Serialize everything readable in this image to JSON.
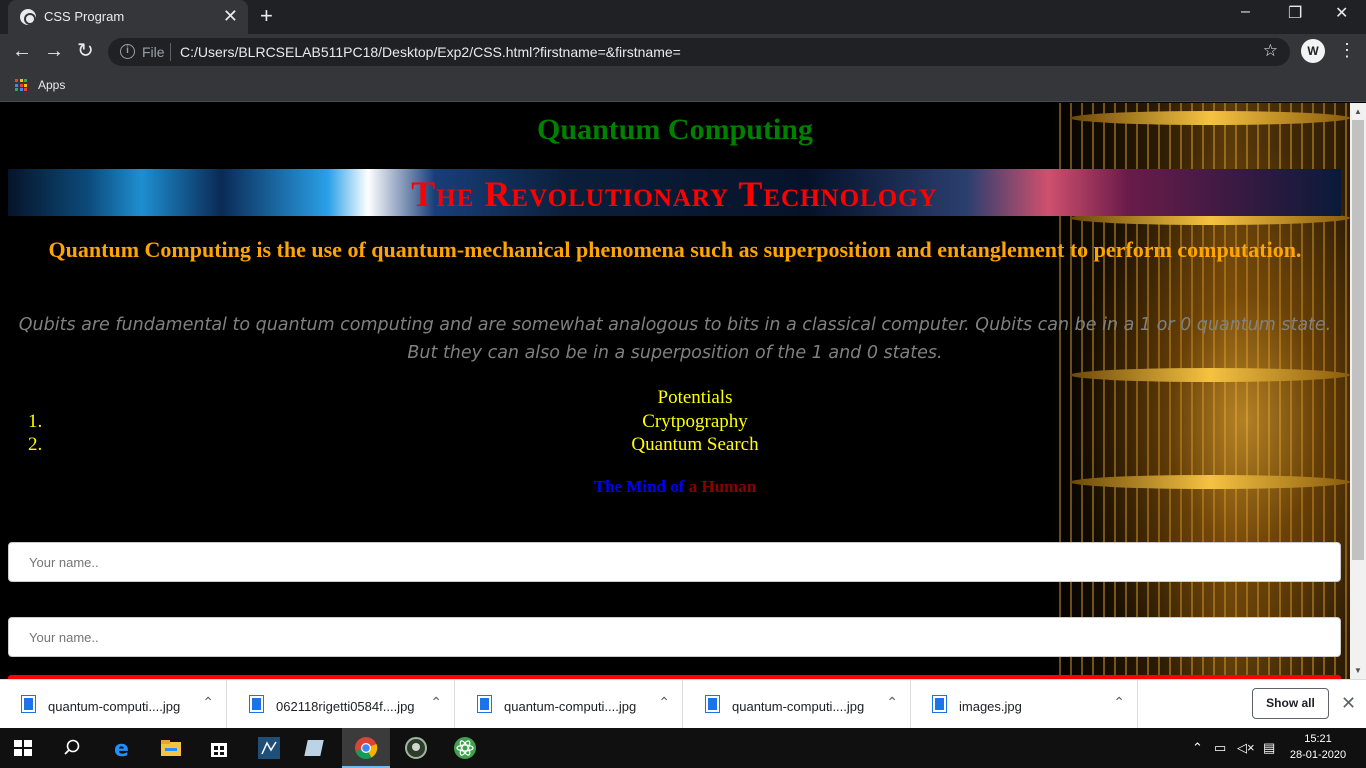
{
  "browser": {
    "tab_title": "CSS Program",
    "tab_close": "✕",
    "new_tab": "+",
    "minimize": "–",
    "restore": "❐",
    "close": "✕",
    "back": "←",
    "forward": "→",
    "reload": "↻",
    "info_glyph": "i",
    "scheme_label": "File",
    "url": "C:/Users/BLRCSELAB511PC18/Desktop/Exp2/CSS.html?firstname=&firstname=",
    "star": "☆",
    "profile_initial": "W",
    "menu": "⋮",
    "bookmarks_apps": "Apps"
  },
  "page": {
    "heading": "Quantum Computing",
    "banner": "The Revolutionary Technology",
    "definition": "Quantum Computing is the use of quantum-mechanical phenomena such as superposition and entanglement to perform computation.",
    "paragraph": "Qubits are fundamental to quantum computing and are somewhat analogous to bits in a classical computer. Qubits can be in a 1 or 0 quantum state. But they can also be in a superposition of the 1 and 0 states.",
    "potentials_title": "Potentials",
    "potentials": [
      {
        "num": "1.",
        "text": "Crytpography"
      },
      {
        "num": "2.",
        "text": "Quantum Search"
      }
    ],
    "mind_part1": "The Mind of",
    "mind_part2": " a Human",
    "input1_placeholder": "Your name..",
    "input2_placeholder": "Your name.."
  },
  "downloads": {
    "items": [
      "quantum-computi....jpg",
      "062118rigetti0584f....jpg",
      "quantum-computi....jpg",
      "quantum-computi....jpg",
      "images.jpg"
    ],
    "show_all": "Show all",
    "close": "✕"
  },
  "taskbar": {
    "time": "15:21",
    "date": "28-01-2020"
  },
  "colors": {
    "heading": "#008000",
    "banner_text": "#ff0000",
    "definition": "#ffa500",
    "paragraph": "#808080",
    "list": "#ffff00",
    "mind_blue": "#0000ff",
    "mind_red": "#8b0000"
  }
}
